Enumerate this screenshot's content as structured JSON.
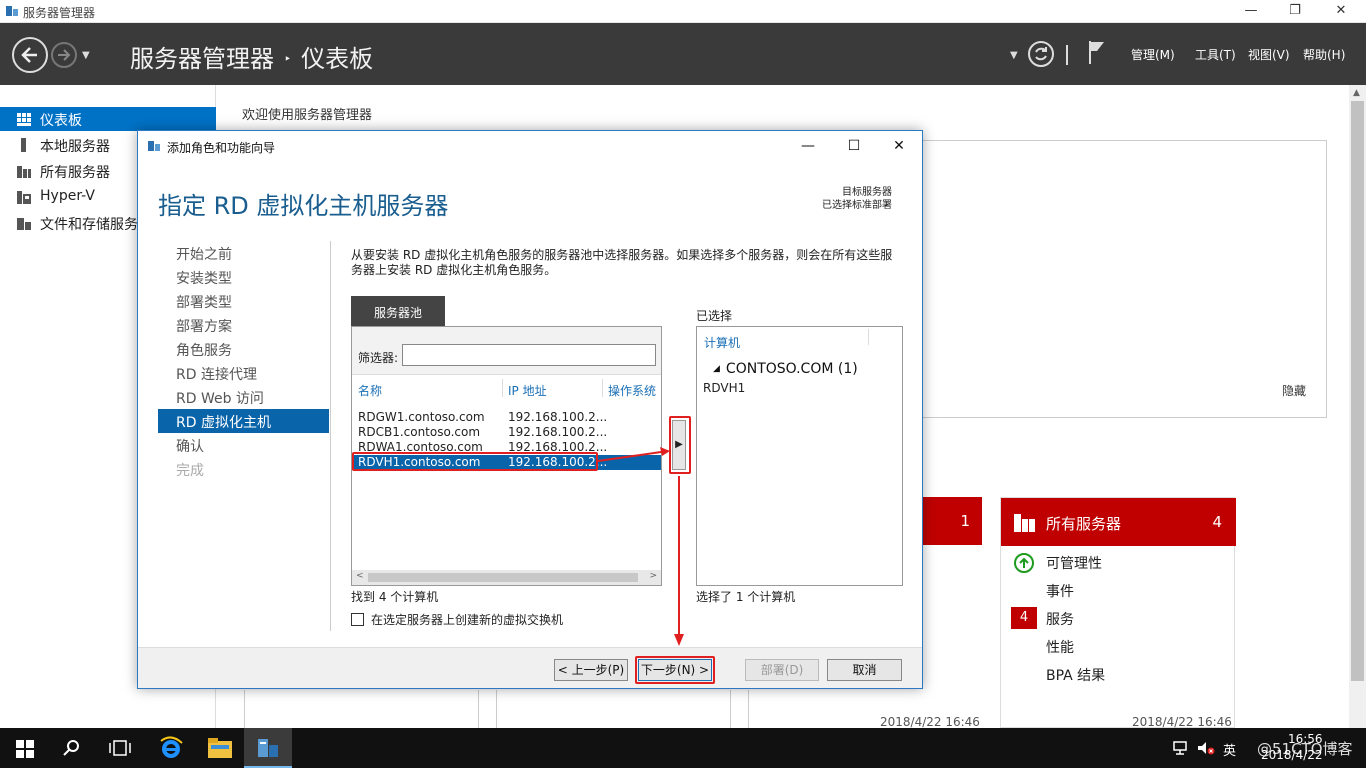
{
  "window": {
    "title": "服务器管理器",
    "controls": {
      "minimize": "—",
      "restore": "❐",
      "close": "✕"
    }
  },
  "header": {
    "app": "服务器管理器",
    "separator": "‣",
    "page": "仪表板",
    "menu": [
      "管理(M)",
      "工具(T)",
      "视图(V)",
      "帮助(H)"
    ]
  },
  "sidebar": {
    "items": [
      {
        "label": "仪表板",
        "icon": "dashboard-icon",
        "active": true
      },
      {
        "label": "本地服务器",
        "icon": "server-icon"
      },
      {
        "label": "所有服务器",
        "icon": "servers-icon"
      },
      {
        "label": "Hyper-V",
        "icon": "hyperv-icon"
      },
      {
        "label": "文件和存储服务",
        "icon": "storage-icon"
      }
    ]
  },
  "main": {
    "welcome": "欢迎使用服务器管理器",
    "hide": "隐藏",
    "tile_partial_count": "1",
    "tile": {
      "title": "所有服务器",
      "count": "4",
      "rows": [
        "可管理性",
        "事件",
        "服务",
        "性能",
        "BPA 结果"
      ],
      "services_badge": "4"
    },
    "timestamps": [
      "2018/4/22 16:46",
      "2018/4/22 16:46"
    ]
  },
  "dialog": {
    "title": "添加角色和功能向导",
    "controls": {
      "minimize": "—",
      "maximize": "☐",
      "close": "✕"
    },
    "heading": "指定 RD 虚拟化主机服务器",
    "destination_label": "目标服务器",
    "destination_value": "已选择标准部署",
    "steps": [
      {
        "label": "开始之前",
        "state": "normal"
      },
      {
        "label": "安装类型",
        "state": "normal"
      },
      {
        "label": "部署类型",
        "state": "normal"
      },
      {
        "label": "部署方案",
        "state": "normal"
      },
      {
        "label": "角色服务",
        "state": "normal"
      },
      {
        "label": "RD 连接代理",
        "state": "normal"
      },
      {
        "label": "RD Web 访问",
        "state": "normal"
      },
      {
        "label": "RD 虚拟化主机",
        "state": "active"
      },
      {
        "label": "确认",
        "state": "normal"
      },
      {
        "label": "完成",
        "state": "disabled"
      }
    ],
    "description": "从要安装 RD 虚拟化主机角色服务的服务器池中选择服务器。如果选择多个服务器，则会在所有这些服务器上安装 RD 虚拟化主机角色服务。",
    "pool": {
      "tab": "服务器池",
      "filter_label": "筛选器:",
      "filter_value": "",
      "columns": [
        "名称",
        "IP 地址",
        "操作系统"
      ],
      "rows": [
        {
          "name": "RDGW1.contoso.com",
          "ip": "192.168.100.2...",
          "selected": false
        },
        {
          "name": "RDCB1.contoso.com",
          "ip": "192.168.100.2...",
          "selected": false
        },
        {
          "name": "RDWA1.contoso.com",
          "ip": "192.168.100.2...",
          "selected": false
        },
        {
          "name": "RDVH1.contoso.com",
          "ip": "192.168.100.2...",
          "selected": true
        }
      ],
      "found": "找到 4 个计算机"
    },
    "add_button": "▶",
    "selected": {
      "label": "已选择",
      "column": "计算机",
      "group": "CONTOSO.COM (1)",
      "group_toggle": "◢",
      "items": [
        "RDVH1"
      ],
      "count": "选择了 1 个计算机"
    },
    "checkbox_label": "在选定服务器上创建新的虚拟交换机",
    "checkbox_checked": false,
    "buttons": {
      "prev": "< 上一步(P)",
      "next": "下一步(N) >",
      "deploy": "部署(D)",
      "cancel": "取消"
    }
  },
  "taskbar": {
    "clock_time": "16:56",
    "clock_date": "2018/4/22",
    "ime": "英",
    "watermark": "@51CTO博客"
  },
  "colors": {
    "accent": "#0072c6",
    "header_bg": "#3a3a3a",
    "tile_red": "#c00000",
    "annotation": "#e02020"
  }
}
